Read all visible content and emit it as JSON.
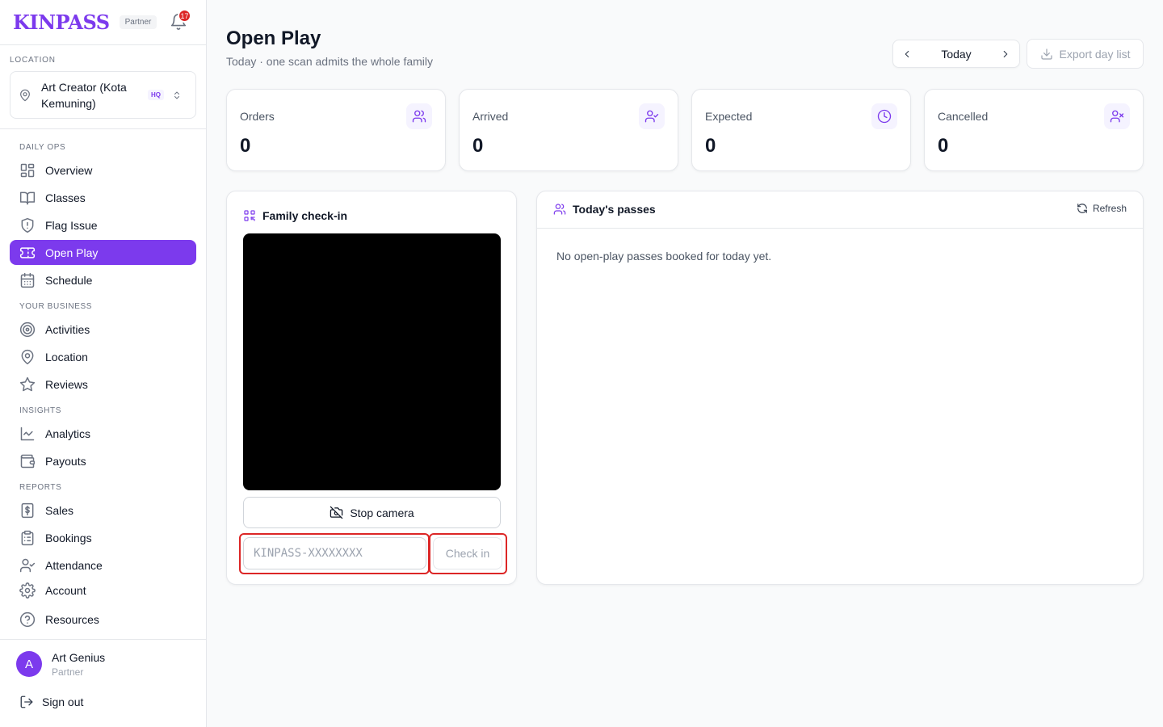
{
  "brand": {
    "logo": "KINPASS",
    "partner_label": "Partner",
    "notif_count": "17"
  },
  "location": {
    "label": "LOCATION",
    "name": "Art Creator (Kota Kemuning)",
    "badge": "HQ"
  },
  "nav": {
    "daily_ops": "DAILY OPS",
    "overview": "Overview",
    "classes": "Classes",
    "flag_issue": "Flag Issue",
    "open_play": "Open Play",
    "schedule": "Schedule",
    "your_business": "YOUR BUSINESS",
    "activities": "Activities",
    "location": "Location",
    "reviews": "Reviews",
    "insights": "INSIGHTS",
    "analytics": "Analytics",
    "payouts": "Payouts",
    "reports": "REPORTS",
    "sales": "Sales",
    "bookings": "Bookings",
    "attendance": "Attendance",
    "account": "Account",
    "resources": "Resources"
  },
  "user": {
    "initial": "A",
    "name": "Art Genius",
    "role": "Partner",
    "sign_out": "Sign out"
  },
  "header": {
    "title": "Open Play",
    "subtitle": "Today · one scan admits the whole family",
    "date_label": "Today",
    "export_label": "Export day list"
  },
  "stats": {
    "orders": {
      "label": "Orders",
      "value": "0"
    },
    "arrived": {
      "label": "Arrived",
      "value": "0"
    },
    "expected": {
      "label": "Expected",
      "value": "0"
    },
    "cancelled": {
      "label": "Cancelled",
      "value": "0"
    }
  },
  "checkin": {
    "title": "Family check-in",
    "stop_camera": "Stop camera",
    "code_placeholder": "KINPASS-XXXXXXXX",
    "code_value": "",
    "check_in": "Check in"
  },
  "passes": {
    "title": "Today's passes",
    "refresh": "Refresh",
    "empty": "No open-play passes booked for today yet."
  },
  "colors": {
    "accent": "#7c3aed",
    "highlight": "#dc2626"
  }
}
